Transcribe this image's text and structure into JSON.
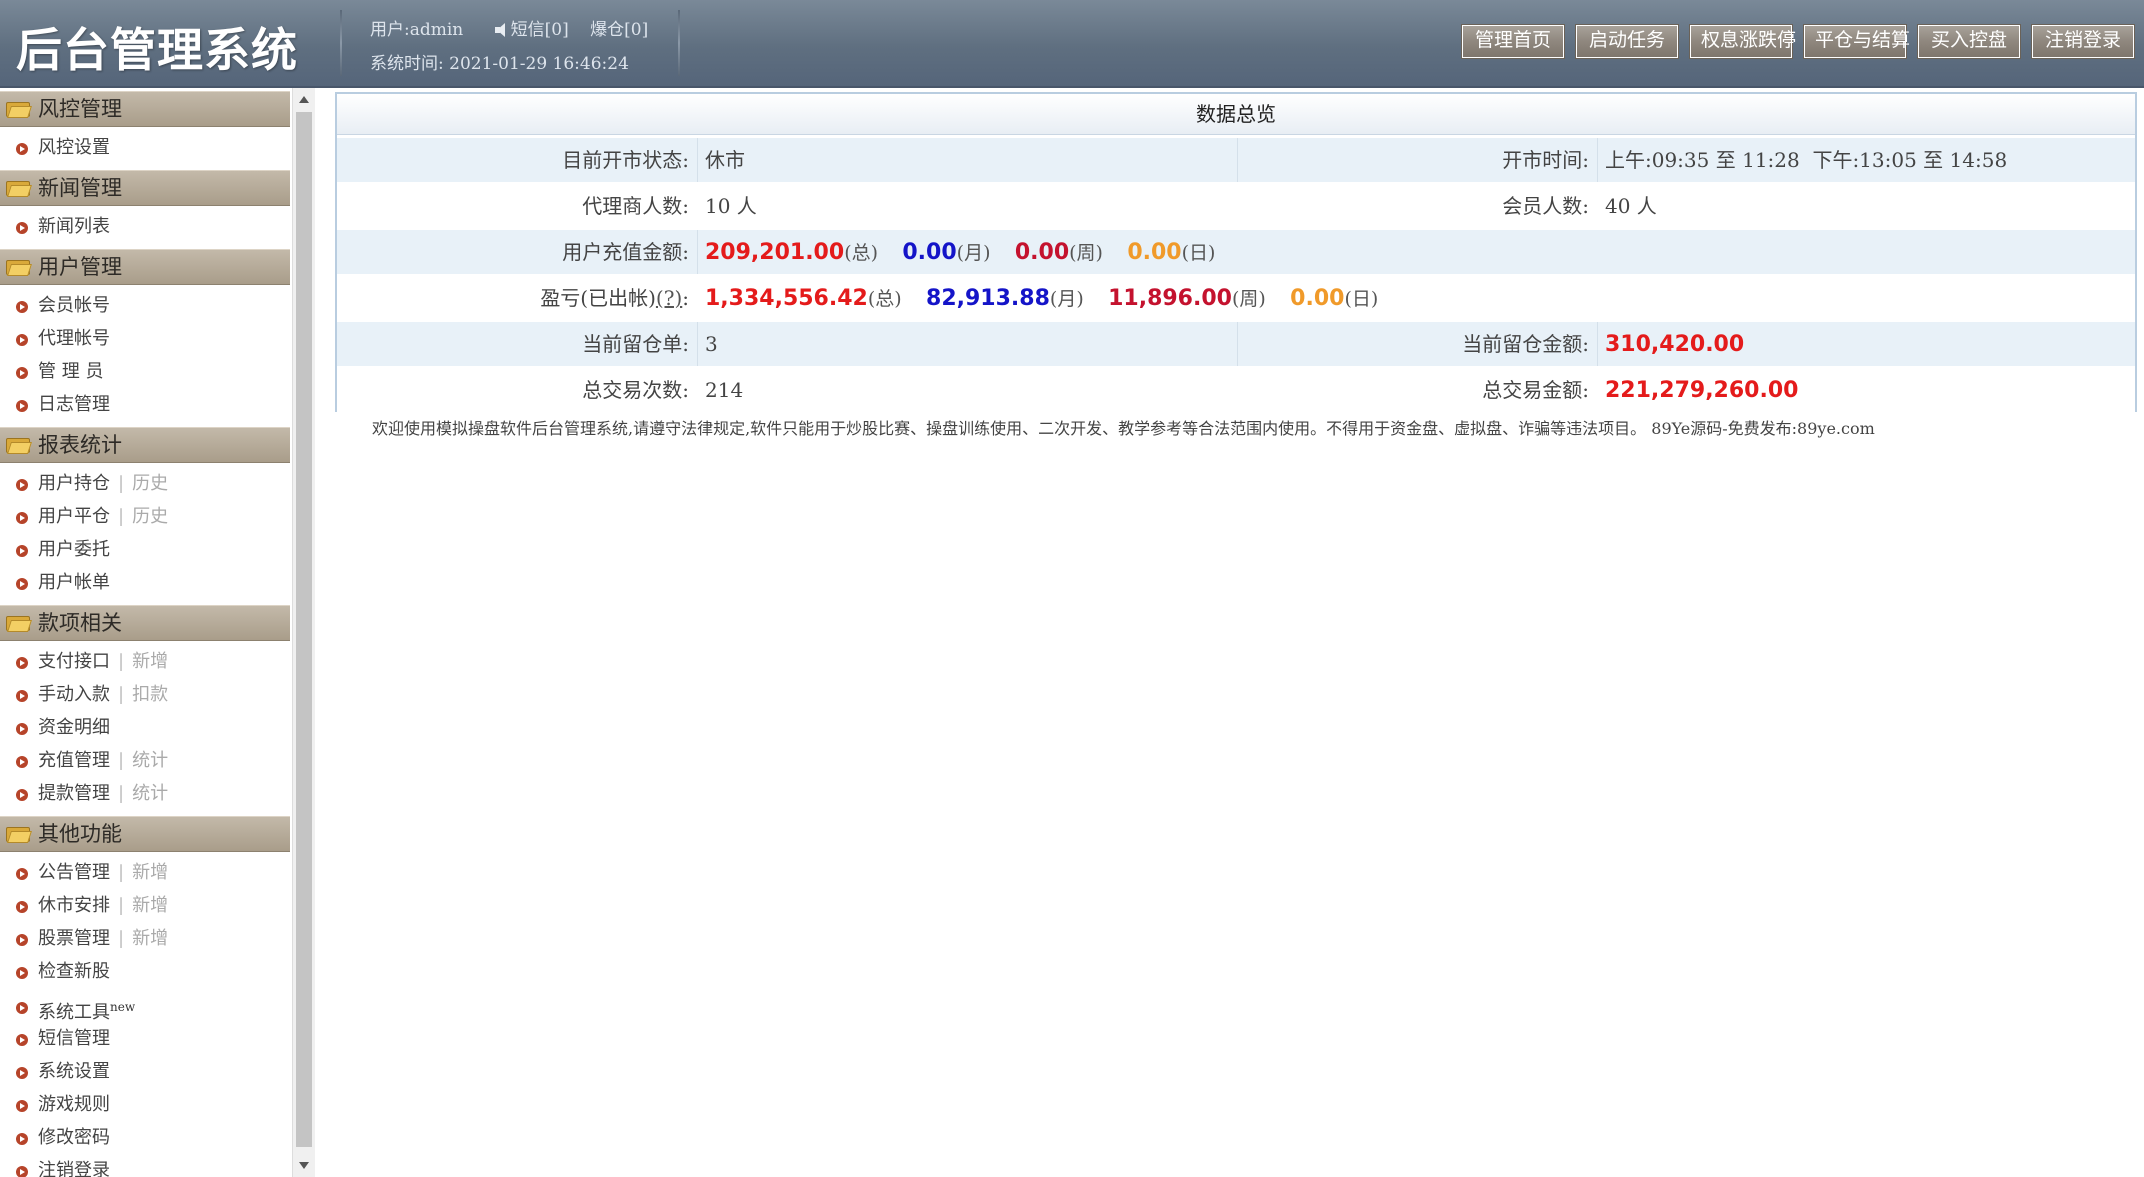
{
  "header": {
    "logo": "后台管理系统",
    "user": "用户:admin",
    "sms": "短信[0]",
    "liquidation": "爆仓[0]",
    "system_time": "系统时间: 2021-01-29 16:46:24",
    "buttons": [
      "管理首页",
      "启动任务",
      "权息涨跌停",
      "平仓与结算",
      "买入控盘",
      "注销登录"
    ]
  },
  "sidebar": {
    "sections": [
      {
        "title": "风控管理",
        "items": [
          {
            "label": "风控设置"
          }
        ]
      },
      {
        "title": "新闻管理",
        "items": [
          {
            "label": "新闻列表"
          }
        ]
      },
      {
        "title": "用户管理",
        "items": [
          {
            "label": "会员帐号"
          },
          {
            "label": "代理帐号"
          },
          {
            "label": "管 理 员"
          },
          {
            "label": "日志管理"
          }
        ]
      },
      {
        "title": "报表统计",
        "items": [
          {
            "label": "用户持仓",
            "sub": "历史"
          },
          {
            "label": "用户平仓",
            "sub": "历史"
          },
          {
            "label": "用户委托"
          },
          {
            "label": "用户帐单"
          }
        ]
      },
      {
        "title": "款项相关",
        "items": [
          {
            "label": "支付接口",
            "sub": "新增"
          },
          {
            "label": "手动入款",
            "sub": "扣款"
          },
          {
            "label": "资金明细"
          },
          {
            "label": "充值管理",
            "sub": "统计"
          },
          {
            "label": "提款管理",
            "sub": "统计"
          }
        ]
      },
      {
        "title": "其他功能",
        "items": [
          {
            "label": "公告管理",
            "sub": "新增"
          },
          {
            "label": "休市安排",
            "sub": "新增"
          },
          {
            "label": "股票管理",
            "sub": "新增"
          },
          {
            "label": "检查新股"
          },
          {
            "label": "系统工具",
            "badge": "new"
          },
          {
            "label": "短信管理"
          },
          {
            "label": "系统设置"
          },
          {
            "label": "游戏规则"
          },
          {
            "label": "修改密码"
          },
          {
            "label": "注销登录"
          }
        ]
      }
    ],
    "separator": "|"
  },
  "overview": {
    "title": "数据总览",
    "market_status_label": "目前开市状态:",
    "market_status": "休市",
    "open_time_label": "开市时间:",
    "open_time": "上午:09:35 至 11:28  下午:13:05 至 14:58",
    "agents_label": "代理商人数:",
    "agents": "10 人",
    "members_label": "会员人数:",
    "members": "40 人",
    "recharge_label": "用户充值金额:",
    "recharge": {
      "total": "209,201.00",
      "total_unit": "(总)",
      "month": "0.00",
      "month_unit": "(月)",
      "week": "0.00",
      "week_unit": "(周)",
      "day": "0.00",
      "day_unit": "(日)"
    },
    "pnl_label_prefix": "盈亏(已出帐)",
    "pnl_help": "(?)",
    "pnl_label_suffix": ":",
    "pnl": {
      "total": "1,334,556.42",
      "total_unit": "(总)",
      "month": "82,913.88",
      "month_unit": "(月)",
      "week": "11,896.00",
      "week_unit": "(周)",
      "day": "0.00",
      "day_unit": "(日)"
    },
    "open_orders_label": "当前留仓单:",
    "open_orders": "3",
    "open_amount_label": "当前留仓金额:",
    "open_amount": "310,420.00",
    "trade_count_label": "总交易次数:",
    "trade_count": "214",
    "trade_amount_label": "总交易金额:",
    "trade_amount": "221,279,260.00"
  },
  "footer_note": "欢迎使用模拟操盘软件后台管理系统,请遵守法律规定,软件只能用于炒股比赛、操盘训练使用、二次开发、教学参考等合法范围内使用。不得用于资金盘、虚拟盘、诈骗等违法项目。 89Ye源码-免费发布:89ye.com",
  "colors": {
    "header_bg": "#5f6f80",
    "section_head": "#b0a592",
    "row_blue": "#e8f1f8",
    "red": "#e41b1b",
    "blue": "#1414c8",
    "crimson": "#c4122e",
    "orange": "#f09a2a"
  },
  "icons": {
    "section": "folder-icon",
    "nav": "bullet-arrow-icon",
    "sms": "speaker-icon"
  }
}
